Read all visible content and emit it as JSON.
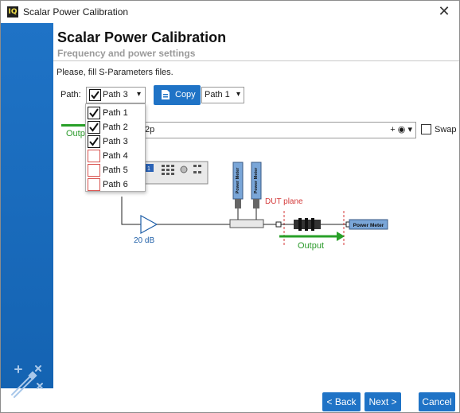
{
  "window": {
    "title": "Scalar Power Calibration",
    "app_icon_text": "IQ"
  },
  "header": {
    "title": "Scalar Power Calibration",
    "subtitle": "Frequency and power settings"
  },
  "instruction": "Please, fill S-Parameters files.",
  "path": {
    "label": "Path:",
    "selected": "Path 3",
    "options": [
      {
        "label": "Path 1",
        "checked": true
      },
      {
        "label": "Path 2",
        "checked": true
      },
      {
        "label": "Path 3",
        "checked": true
      },
      {
        "label": "Path 4",
        "checked": false
      },
      {
        "label": "Path 5",
        "checked": false
      },
      {
        "label": "Path 6",
        "checked": false
      }
    ]
  },
  "copy_button": "Copy",
  "copy_target": "Path 1",
  "file": {
    "value": "2p",
    "swap_label": "Swap"
  },
  "diagram": {
    "output_left": "Outp",
    "attenuation": "20 dB",
    "dut_plane": "DUT plane",
    "output": "Output",
    "power_meter_vertical": "Power Meter",
    "power_meter_right": "Power Meter",
    "instrument_display": "1"
  },
  "footer": {
    "back": "< Back",
    "next": "Next >",
    "cancel": "Cancel"
  },
  "colors": {
    "accent": "#1f73c6",
    "output_green": "#28a028",
    "dut_red": "#d43a3a",
    "unchecked_border": "#d9534f"
  }
}
